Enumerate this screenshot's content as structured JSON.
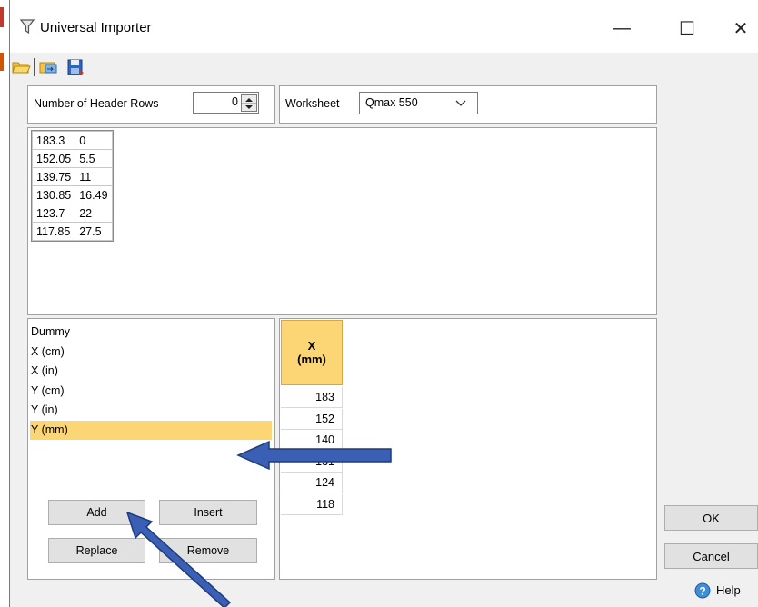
{
  "window": {
    "title": "Universal Importer",
    "minimize": "—",
    "maximize": "☐",
    "close": "✕"
  },
  "header": {
    "rows_label": "Number of Header Rows",
    "rows_value": "0",
    "worksheet_label": "Worksheet",
    "worksheet_value": "Qmax 550"
  },
  "preview": {
    "rows": [
      [
        "183.3",
        "0"
      ],
      [
        "152.05",
        "5.5"
      ],
      [
        "139.75",
        "11"
      ],
      [
        "130.85",
        "16.49"
      ],
      [
        "123.7",
        "22"
      ],
      [
        "117.85",
        "27.5"
      ]
    ]
  },
  "columns_list": {
    "items": [
      "Dummy",
      "X (cm)",
      "X (in)",
      "Y (cm)",
      "Y (in)",
      "Y (mm)"
    ],
    "selected": "Y (mm)"
  },
  "list_buttons": {
    "add": "Add",
    "insert": "Insert",
    "replace": "Replace",
    "remove": "Remove"
  },
  "grid": {
    "header_line1": "X",
    "header_line2": "(mm)",
    "values": [
      "183",
      "152",
      "140",
      "131",
      "124",
      "118"
    ]
  },
  "dialog_buttons": {
    "ok": "OK",
    "cancel": "Cancel",
    "help": "Help"
  },
  "colors": {
    "selection": "#fcd574",
    "arrow": "#3a5fb4"
  }
}
